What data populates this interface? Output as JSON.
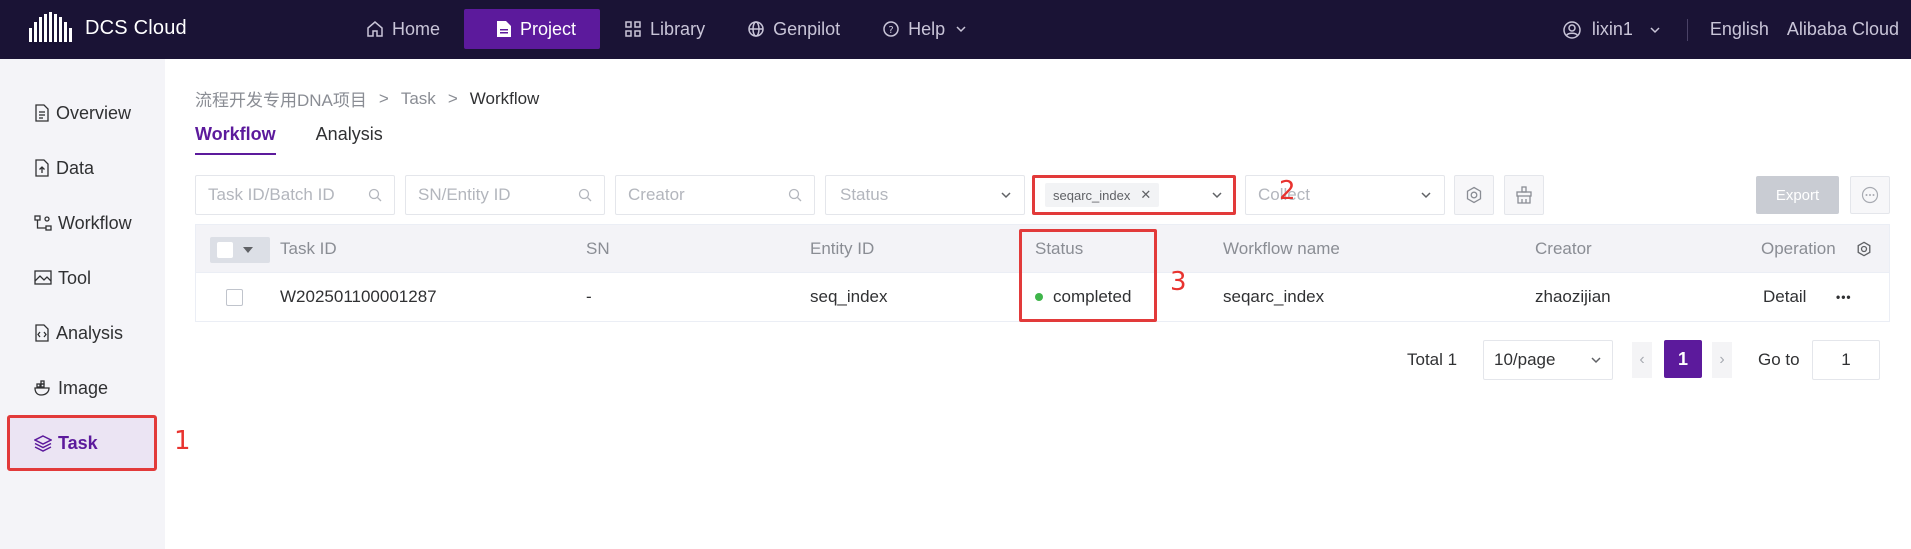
{
  "app": {
    "name": "DCS Cloud"
  },
  "nav": {
    "items": [
      {
        "label": "Home",
        "icon": "home-icon"
      },
      {
        "label": "Project",
        "icon": "document-icon",
        "active": true
      },
      {
        "label": "Library",
        "icon": "grid-icon"
      },
      {
        "label": "Genpilot",
        "icon": "globe-icon"
      },
      {
        "label": "Help",
        "icon": "help-icon"
      }
    ],
    "user": "lixin1",
    "language": "English",
    "region": "Alibaba Cloud"
  },
  "sidebar": {
    "items": [
      {
        "label": "Overview",
        "icon": "file-text-icon"
      },
      {
        "label": "Data",
        "icon": "file-upload-icon"
      },
      {
        "label": "Workflow",
        "icon": "workflow-icon"
      },
      {
        "label": "Tool",
        "icon": "image-icon"
      },
      {
        "label": "Analysis",
        "icon": "code-icon"
      },
      {
        "label": "Image",
        "icon": "docker-icon"
      },
      {
        "label": "Task",
        "icon": "layers-icon",
        "active": true
      }
    ]
  },
  "annotations": {
    "a1": "1",
    "a2": "2",
    "a3": "3"
  },
  "breadcrumb": {
    "project": "流程开发专用DNA项目",
    "sep": ">",
    "task": "Task",
    "current": "Workflow"
  },
  "tabs": [
    {
      "label": "Workflow",
      "active": true
    },
    {
      "label": "Analysis"
    }
  ],
  "filters": {
    "task_id_placeholder": "Task ID/Batch ID",
    "sn_placeholder": "SN/Entity ID",
    "creator_placeholder": "Creator",
    "status_placeholder": "Status",
    "workflow_tag": "seqarc_index",
    "collect_placeholder": "Collect",
    "export_label": "Export"
  },
  "table": {
    "columns": {
      "task_id": "Task ID",
      "sn": "SN",
      "entity_id": "Entity ID",
      "status": "Status",
      "workflow_name": "Workflow name",
      "creator": "Creator",
      "operation": "Operation"
    },
    "rows": [
      {
        "task_id": "W202501100001287",
        "sn": "-",
        "entity_id": "seq_index",
        "status": "completed",
        "workflow_name": "seqarc_index",
        "creator": "zhaozijian",
        "detail": "Detail",
        "more": "•••"
      }
    ]
  },
  "pagination": {
    "total_label": "Total 1",
    "page_size": "10/page",
    "current_page": "1",
    "goto_label": "Go to",
    "goto_value": "1"
  },
  "colors": {
    "brand": "#5c1a9c",
    "topbar": "#1a1335",
    "annotation": "#e23a3a",
    "status_ok": "#3fb54a"
  }
}
